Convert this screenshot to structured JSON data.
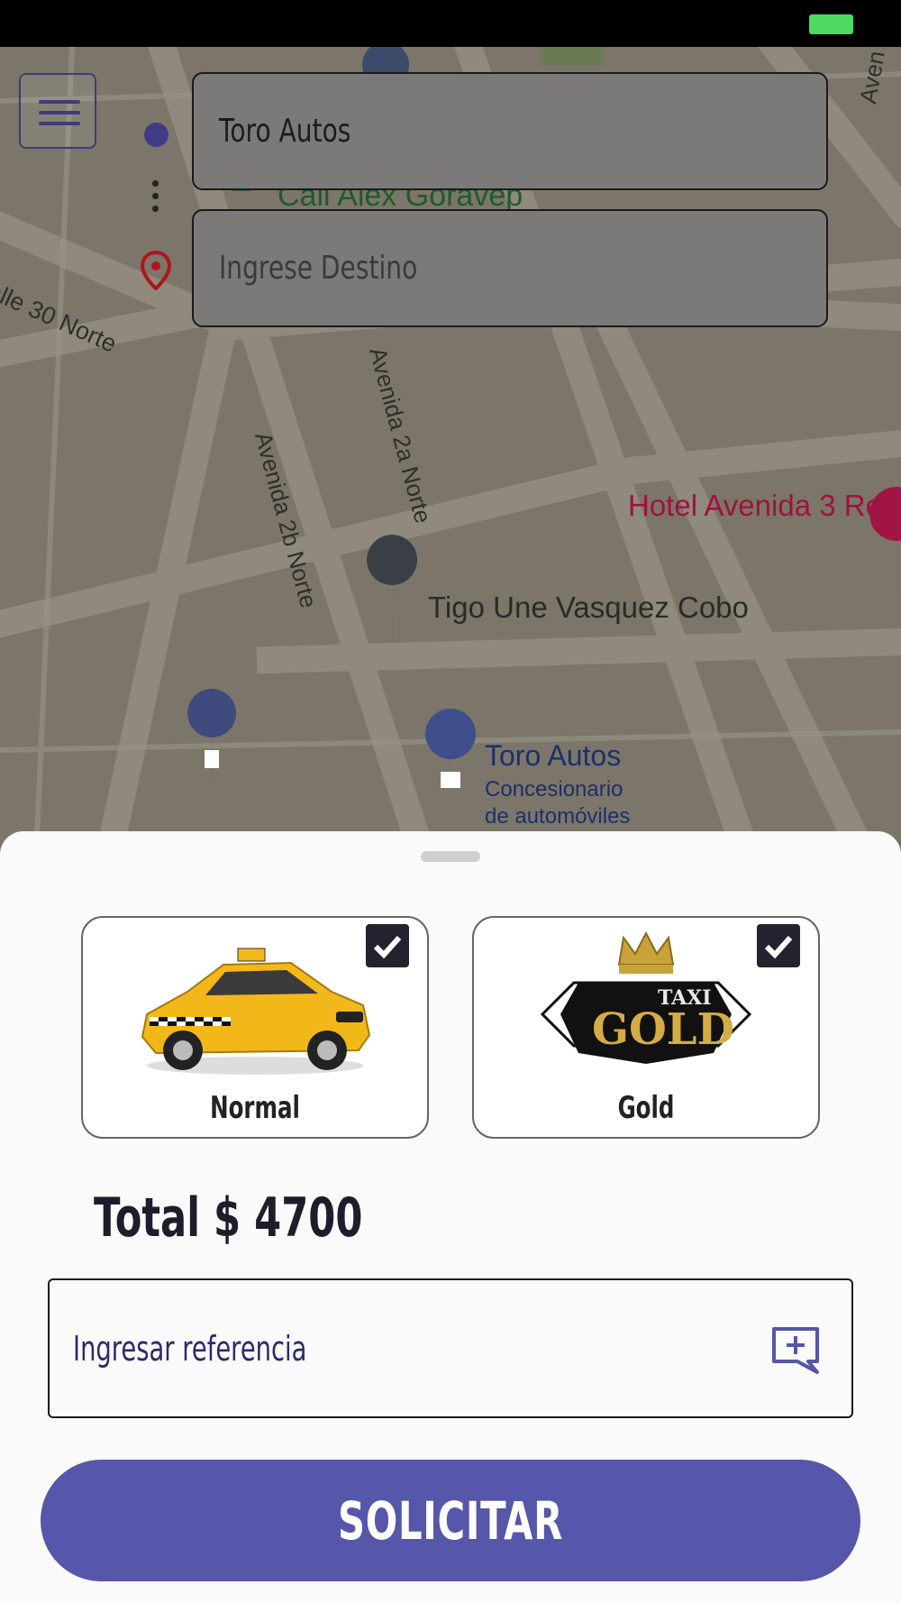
{
  "colors": {
    "accent": "#5656aa",
    "battery": "#4cd964",
    "map_bg": "#7b7669",
    "origin_dot": "#3f3c86",
    "dest_pin": "#b0141a"
  },
  "map": {
    "labels": {
      "street_calle30": "alle 30 Norte",
      "street_av2a": "Avenida 2a Norte",
      "street_av2b": "Avenida 2b Norte",
      "street_aven": "Aven",
      "poi_goravep": "Call Alex Goravep",
      "poi_hotel": "Hotel Avenida 3 Re",
      "poi_tigo": "Tigo Une Vasquez Cobo",
      "poi_toro": "Toro Autos",
      "poi_toro_sub1": "Concesionario",
      "poi_toro_sub2": "de automóviles"
    }
  },
  "route": {
    "origin_value": "Toro Autos",
    "destination_placeholder": "Ingrese Destino"
  },
  "services": [
    {
      "label": "Normal",
      "checked": true,
      "image": "yellow-taxi-car"
    },
    {
      "label": "Gold",
      "checked": true,
      "image": "taxi-gold-logo",
      "logo_top": "TAXI",
      "logo_main": "GOLD"
    }
  ],
  "total": "Total $ 4700",
  "reference": {
    "placeholder": "Ingresar referencia",
    "icon": "add-comment-icon"
  },
  "submit_label": "SOLICITAR"
}
